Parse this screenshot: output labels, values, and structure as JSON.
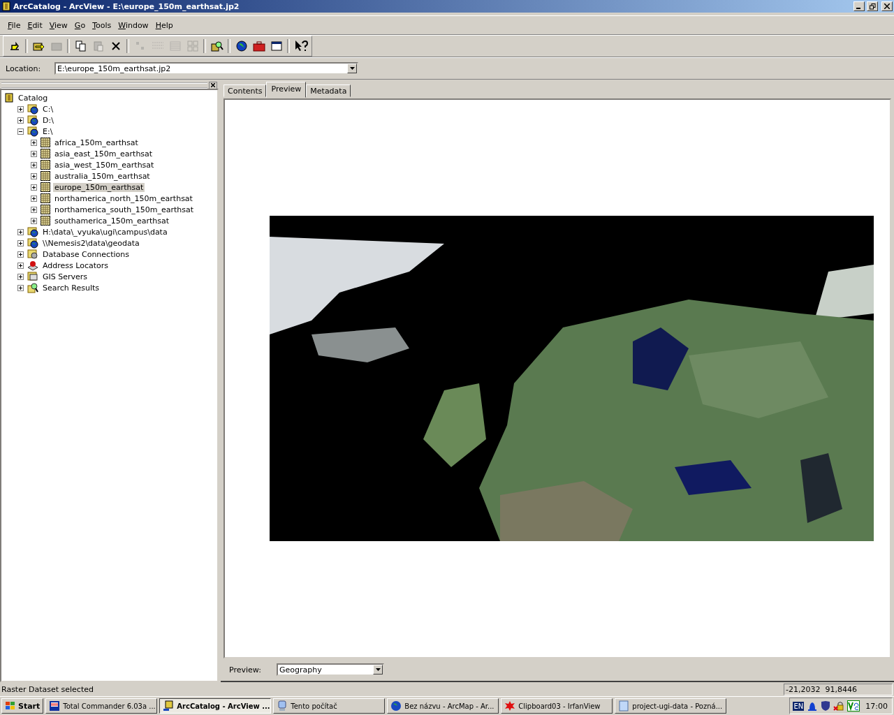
{
  "window": {
    "title": "ArcCatalog - ArcView - E:\\europe_150m_earthsat.jp2"
  },
  "menu": [
    "File",
    "Edit",
    "View",
    "Go",
    "Tools",
    "Window",
    "Help"
  ],
  "toolbar": [
    {
      "kind": "up",
      "disabled": false
    },
    {
      "kind": "sep"
    },
    {
      "kind": "connect",
      "disabled": false
    },
    {
      "kind": "disconnect",
      "disabled": true
    },
    {
      "kind": "sep"
    },
    {
      "kind": "copy",
      "disabled": false
    },
    {
      "kind": "paste",
      "disabled": true
    },
    {
      "kind": "delete",
      "disabled": false
    },
    {
      "kind": "sep"
    },
    {
      "kind": "large",
      "disabled": true
    },
    {
      "kind": "list",
      "disabled": true
    },
    {
      "kind": "details",
      "disabled": true
    },
    {
      "kind": "thumbs",
      "disabled": true
    },
    {
      "kind": "sep"
    },
    {
      "kind": "search",
      "disabled": false
    },
    {
      "kind": "sep"
    },
    {
      "kind": "globe",
      "disabled": false
    },
    {
      "kind": "toolbox",
      "disabled": false
    },
    {
      "kind": "window",
      "disabled": false
    },
    {
      "kind": "sep"
    },
    {
      "kind": "help",
      "disabled": false
    }
  ],
  "location": {
    "label": "Location:",
    "value": "E:\\europe_150m_earthsat.jp2"
  },
  "tree": {
    "label": "Catalog",
    "kind": "catalog",
    "children": [
      {
        "label": "C:\\",
        "kind": "drive",
        "expanded": false,
        "selected": false
      },
      {
        "label": "D:\\",
        "kind": "drive",
        "expanded": false,
        "selected": false
      },
      {
        "label": "E:\\",
        "kind": "drive",
        "expanded": true,
        "selected": false,
        "children": [
          {
            "label": "africa_150m_earthsat",
            "kind": "raster",
            "expanded": false,
            "selected": false
          },
          {
            "label": "asia_east_150m_earthsat",
            "kind": "raster",
            "expanded": false,
            "selected": false
          },
          {
            "label": "asia_west_150m_earthsat",
            "kind": "raster",
            "expanded": false,
            "selected": false
          },
          {
            "label": "australia_150m_earthsat",
            "kind": "raster",
            "expanded": false,
            "selected": false
          },
          {
            "label": "europe_150m_earthsat",
            "kind": "raster",
            "expanded": false,
            "selected": true
          },
          {
            "label": "northamerica_north_150m_earthsat",
            "kind": "raster",
            "expanded": false,
            "selected": false
          },
          {
            "label": "northamerica_south_150m_earthsat",
            "kind": "raster",
            "expanded": false,
            "selected": false
          },
          {
            "label": "southamerica_150m_earthsat",
            "kind": "raster",
            "expanded": false,
            "selected": false
          }
        ]
      },
      {
        "label": "H:\\data\\_vyuka\\ugi\\campus\\data",
        "kind": "drive",
        "expanded": false,
        "selected": false
      },
      {
        "label": "\\\\Nemesis2\\data\\geodata",
        "kind": "drive",
        "expanded": false,
        "selected": false
      },
      {
        "label": "Database Connections",
        "kind": "database",
        "expanded": false,
        "selected": false
      },
      {
        "label": "Address Locators",
        "kind": "locator",
        "expanded": false,
        "selected": false
      },
      {
        "label": "GIS Servers",
        "kind": "server",
        "expanded": false,
        "selected": false
      },
      {
        "label": "Search Results",
        "kind": "search",
        "expanded": false,
        "selected": false
      }
    ]
  },
  "tabs": [
    {
      "label": "Contents",
      "selected": false
    },
    {
      "label": "Preview",
      "selected": true
    },
    {
      "label": "Metadata",
      "selected": false
    }
  ],
  "preview": {
    "label": "Preview:",
    "value": "Geography"
  },
  "status_bar": {
    "message": "Raster Dataset selected",
    "coordinates": "-21,2032  91,8446"
  },
  "taskbar": {
    "start": "Start",
    "tasks": [
      {
        "label": "Total Commander 6.03a ...",
        "kind": "disk",
        "selected": false
      },
      {
        "label": "ArcCatalog - ArcView ...",
        "kind": "catalog",
        "selected": true
      },
      {
        "label": "Tento počítač",
        "kind": "computer",
        "selected": false
      },
      {
        "label": "Bez názvu - ArcMap - Ar...",
        "kind": "globe",
        "selected": false
      },
      {
        "label": "Clipboard03 - IrfanView",
        "kind": "splash",
        "selected": false
      },
      {
        "label": "project-ugi-data - Pozná...",
        "kind": "note",
        "selected": false
      }
    ],
    "language": "EN",
    "clock": "17:00"
  }
}
